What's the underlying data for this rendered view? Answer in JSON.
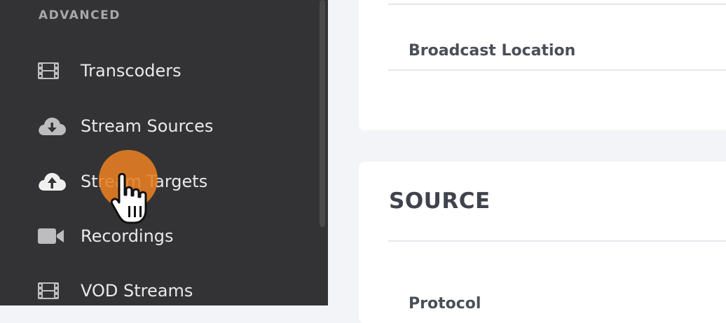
{
  "sidebar": {
    "section_label": "ADVANCED",
    "items": [
      {
        "label": "Transcoders",
        "icon": "film-icon"
      },
      {
        "label": "Stream Sources",
        "icon": "cloud-download-icon"
      },
      {
        "label": "Stream Targets",
        "icon": "cloud-upload-icon"
      },
      {
        "label": "Recordings",
        "icon": "video-camera-icon"
      },
      {
        "label": "VOD Streams",
        "icon": "film-icon"
      }
    ]
  },
  "main": {
    "card1": {
      "field_label": "Broadcast Location"
    },
    "card2": {
      "section_title": "SOURCE",
      "field_label": "Protocol"
    }
  },
  "colors": {
    "sidebar_bg": "#333335",
    "main_bg": "#f3f4f7",
    "cursor_highlight": "#e88023"
  }
}
